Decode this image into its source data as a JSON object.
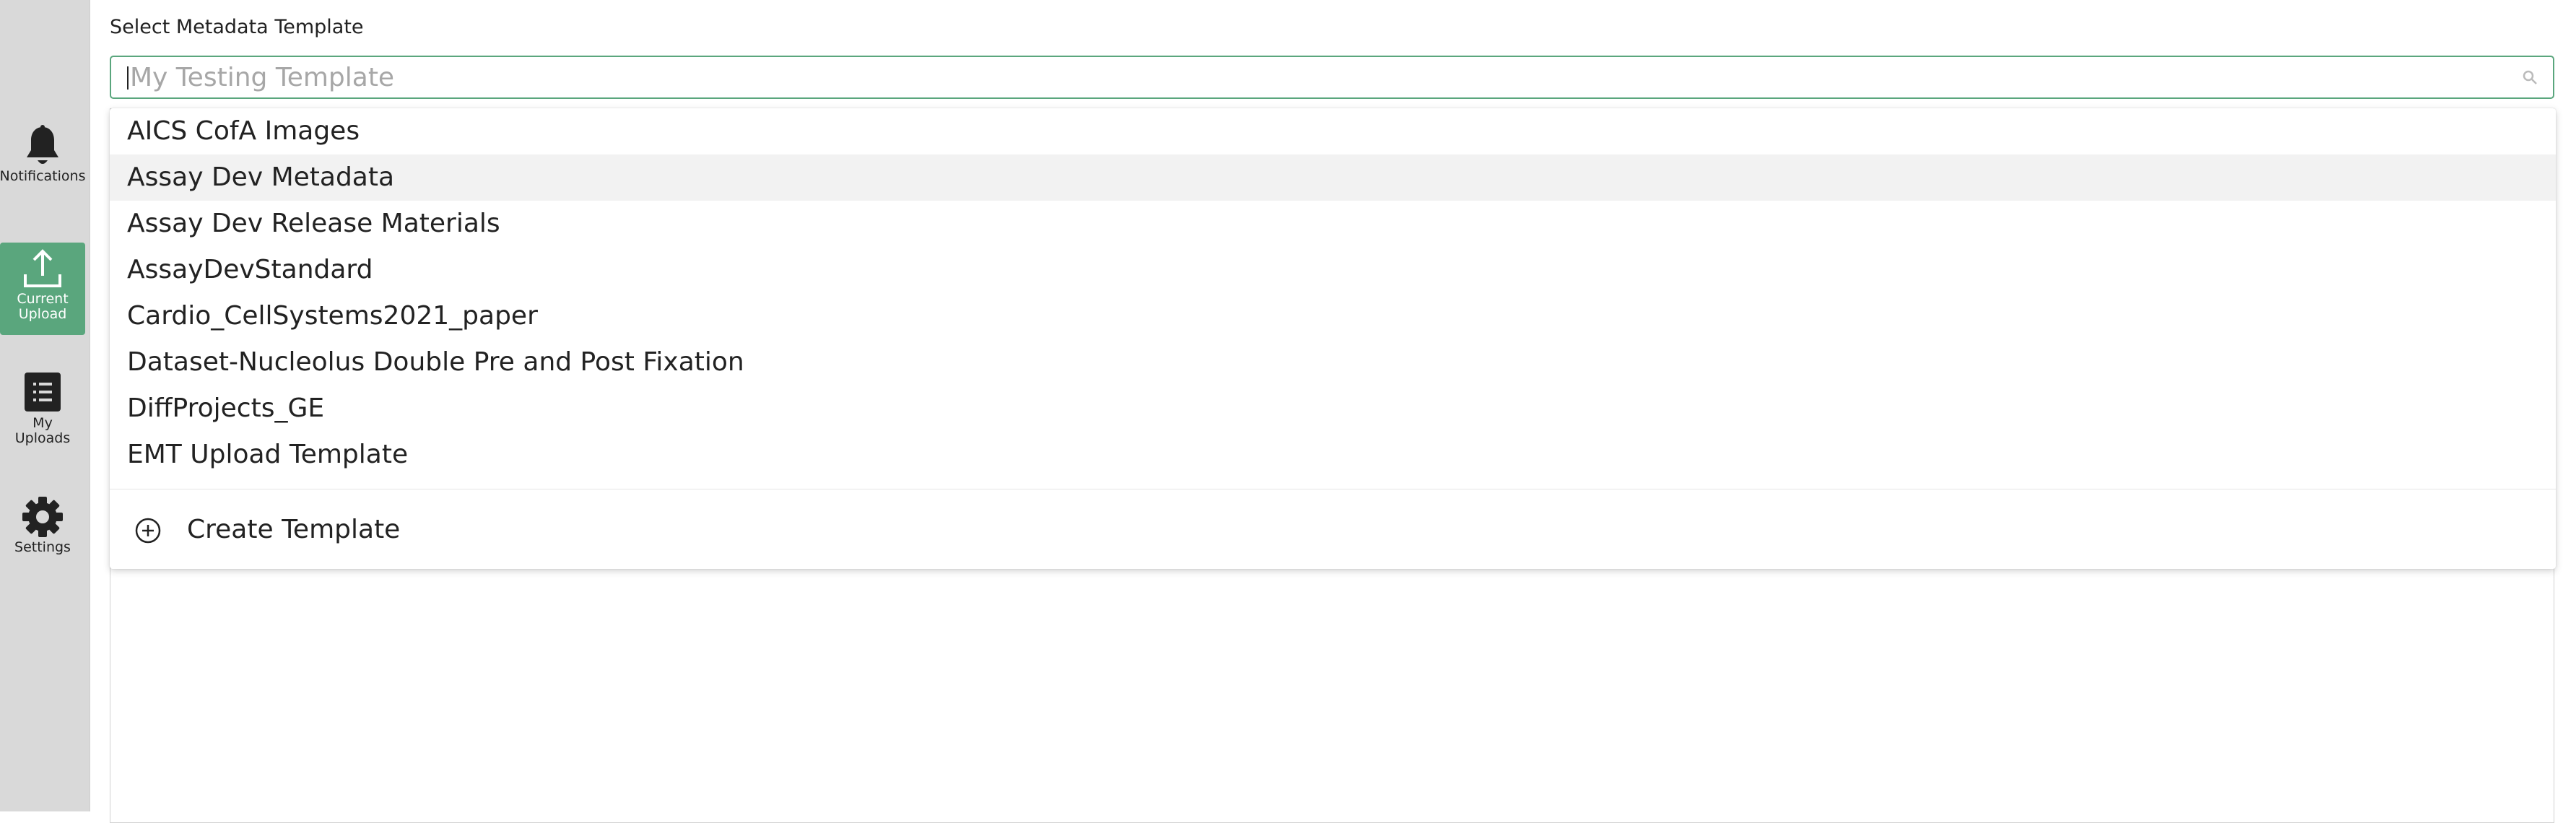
{
  "sidebar": {
    "items": [
      {
        "label": "Notifications",
        "icon": "bell-icon",
        "active": false
      },
      {
        "label_line1": "Current",
        "label_line2": "Upload",
        "icon": "upload-icon",
        "active": true
      },
      {
        "label_line1": "My",
        "label_line2": "Uploads",
        "icon": "list-icon",
        "active": false
      },
      {
        "label": "Settings",
        "icon": "gear-icon",
        "active": false
      }
    ]
  },
  "template_select": {
    "label": "Select Metadata Template",
    "placeholder": "My Testing Template",
    "options": [
      "AICS CofA Images",
      "Assay Dev Metadata",
      "Assay Dev Release Materials",
      "AssayDevStandard",
      "Cardio_CellSystems2021_paper",
      "Dataset-Nucleolus Double Pre and Post Fixation",
      "DiffProjects_GE",
      "EMT Upload Template"
    ],
    "hovered_option": "Assay Dev Metadata",
    "create_label": "Create Template"
  },
  "colors": {
    "accent": "#5aa67d",
    "sidebar_bg": "#d9d9d9",
    "hover_bg": "#f2f2f2"
  }
}
